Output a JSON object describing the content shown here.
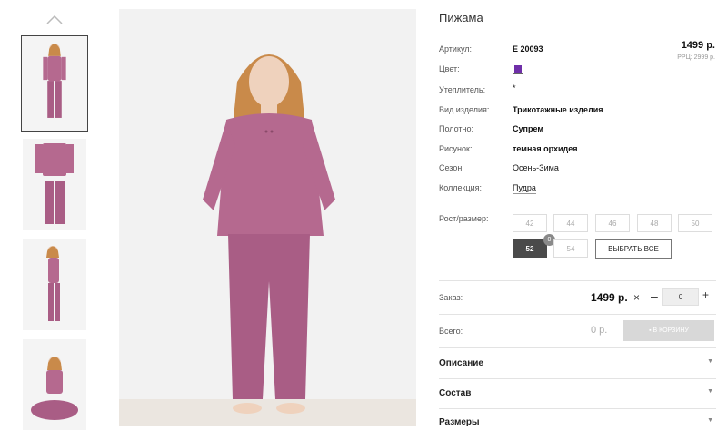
{
  "product": {
    "title": "Пижама",
    "price": "1499 р.",
    "rrp": "РРЦ: 2999 р.",
    "color_hex": "#6f2fa8"
  },
  "props": [
    {
      "label": "Артикул:",
      "value": "E 20093",
      "style": "bold"
    },
    {
      "label": "Цвет:",
      "value": "",
      "style": "swatch"
    },
    {
      "label": "Утеплитель:",
      "value": "*",
      "style": "plain"
    },
    {
      "label": "Вид изделия:",
      "value": "Трикотажные изделия",
      "style": "bold"
    },
    {
      "label": "Полотно:",
      "value": "Супрем",
      "style": "bold"
    },
    {
      "label": "Рисунок:",
      "value": "темная орхидея",
      "style": "bold"
    },
    {
      "label": "Сезон:",
      "value": "Осень-Зима",
      "style": "plain"
    },
    {
      "label": "Коллекция:",
      "value": "Пудра",
      "style": "link"
    }
  ],
  "sizes": {
    "label": "Рост/размер:",
    "options": [
      "42",
      "44",
      "46",
      "48",
      "50",
      "52",
      "54"
    ],
    "selected": "52",
    "badge": "0",
    "select_all": "ВЫБРАТЬ ВСЕ"
  },
  "order": {
    "label": "Заказ:",
    "price": "1499 р.",
    "x_symbol": "×",
    "minus": "–",
    "qty": "0",
    "plus": "+"
  },
  "total": {
    "label": "Всего:",
    "value": "0 р.",
    "cart_button": "В КОРЗИНУ"
  },
  "accordions": [
    "Описание",
    "Состав",
    "Размеры"
  ],
  "gallery": {
    "thumbs": 4,
    "garment_color": "#b5698f"
  }
}
